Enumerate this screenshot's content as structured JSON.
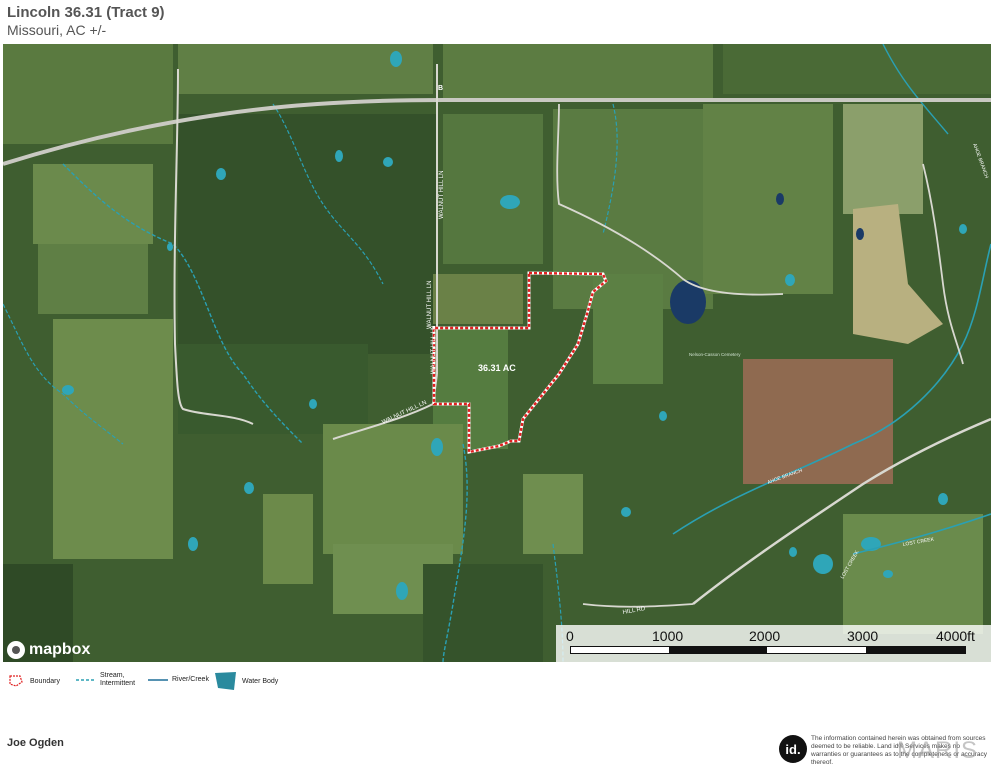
{
  "header": {
    "title": "Lincoln 36.31 (Tract 9)",
    "subtitle": "Missouri,  AC +/-"
  },
  "map": {
    "parcel_label": "36.31 AC",
    "boundary_color": "#e02020",
    "water_color": "#2fa6b8",
    "road_labels": {
      "walnut_hill_ln_1": "WALNUT HILL LN",
      "walnut_hill_ln_2": "WALNUT HILL LN",
      "walnut_hill_ln_3": "WALNUT HILL LN",
      "walnut_hill_ln_4": "WALNUT HILL LN",
      "cemetery": "Nelson-Casson Cemetery",
      "ahoe_branch_1": "AHOE BRANCH",
      "ahoe_branch_2": "AHOE BRANCH",
      "lost_creek_1": "LOST CREEK",
      "lost_creek_2": "LOST CREEK",
      "hill_rd": "HILL RD",
      "route_b": "B"
    },
    "attribution": "mapbox"
  },
  "scale": {
    "ticks": [
      "0",
      "1000",
      "2000",
      "3000",
      "4000ft"
    ]
  },
  "legend": {
    "items": [
      {
        "label": "Boundary"
      },
      {
        "label": "Stream,\nIntermittent"
      },
      {
        "label": "River/Creek"
      },
      {
        "label": "Water Body"
      }
    ]
  },
  "footer": {
    "agent": "Joe  Ogden",
    "logo_text": "id.",
    "disclaimer": "The information contained herein was obtained from sources deemed to be reliable. Land id® Services makes no warranties or guarantees as to the completeness or accuracy thereof.",
    "watermark": "MARIS"
  }
}
